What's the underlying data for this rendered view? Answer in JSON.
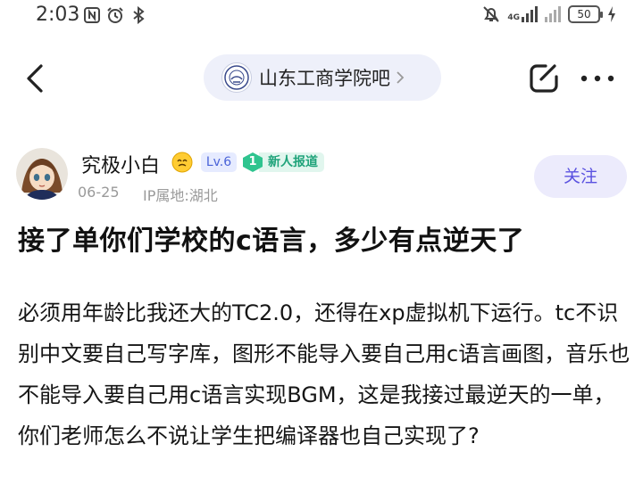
{
  "status_bar": {
    "time": "2:03",
    "battery": "50",
    "network_label": "4G"
  },
  "nav": {
    "forum_name": "山东工商学院吧"
  },
  "author": {
    "name": "究极小白",
    "level": "Lv.6",
    "badge_number": "1",
    "badge_label": "新人报道",
    "date": "06-25",
    "ip_location": "IP属地:湖北",
    "follow_label": "关注"
  },
  "post": {
    "title": "接了单你们学校的c语言，多少有点逆天了",
    "body": "必须用年龄比我还大的TC2.0，还得在xp虚拟机下运行。tc不识别中文要自己写字库，图形不能导入要自己用c语言画图，音乐也不能导入要自己用c语言实现BGM，这是我接过最逆天的一单，你们老师怎么不说让学生把编译器也自己实现了?"
  },
  "colors": {
    "accent": "#5a52e0",
    "follow_bg": "#ecebfc",
    "level_badge": "#4a63d8",
    "newbie_badge": "#1fa37a"
  },
  "icons": [
    "nfc-icon",
    "alarm-icon",
    "bluetooth-icon",
    "mute-icon",
    "signal-icon",
    "battery-icon",
    "back-icon",
    "forum-logo-icon",
    "chevron-right-icon",
    "edit-icon",
    "more-icon",
    "emoji-icon",
    "gem-badge-icon"
  ]
}
